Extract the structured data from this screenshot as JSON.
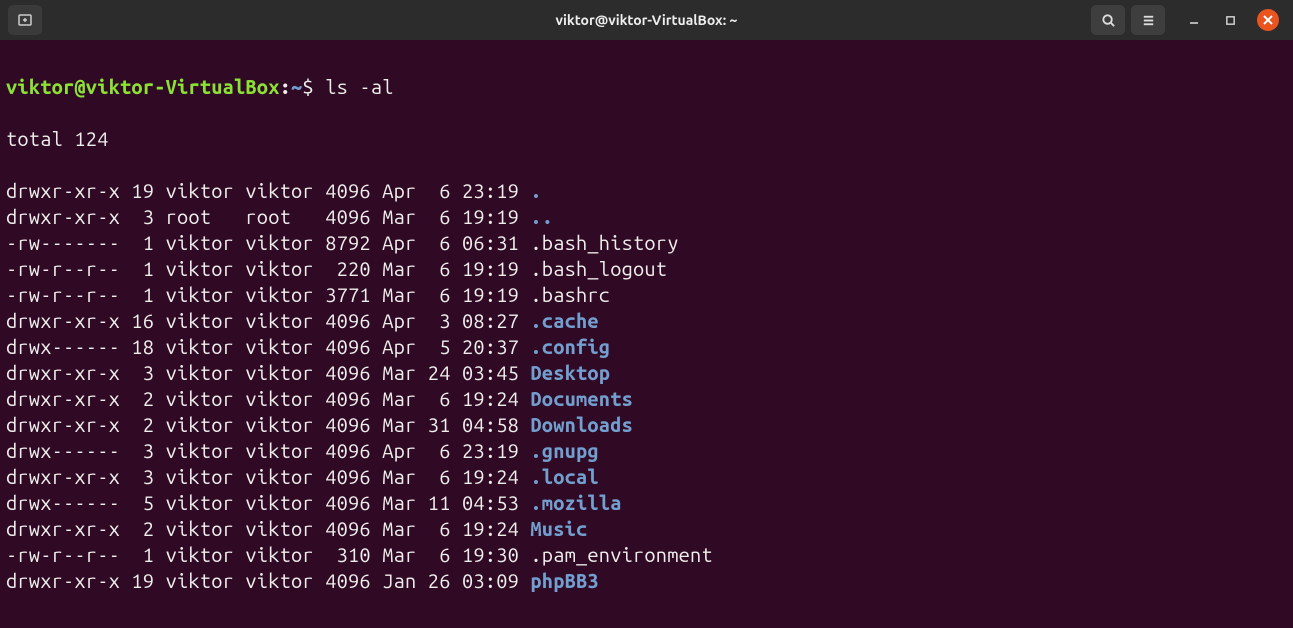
{
  "window": {
    "title": "viktor@viktor-VirtualBox: ~"
  },
  "prompt": {
    "user_host": "viktor@viktor-VirtualBox",
    "colon": ":",
    "path": "~",
    "symbol": "$",
    "command": "ls -al"
  },
  "total_line": "total 124",
  "listing": [
    {
      "perm": "drwxr-xr-x",
      "links": "19",
      "owner": "viktor",
      "group": "viktor",
      "size": "4096",
      "month": "Apr",
      "day": " 6",
      "time": "23:19",
      "name": ".",
      "dir": true
    },
    {
      "perm": "drwxr-xr-x",
      "links": " 3",
      "owner": "root  ",
      "group": "root  ",
      "size": "4096",
      "month": "Mar",
      "day": " 6",
      "time": "19:19",
      "name": "..",
      "dir": true
    },
    {
      "perm": "-rw-------",
      "links": " 1",
      "owner": "viktor",
      "group": "viktor",
      "size": "8792",
      "month": "Apr",
      "day": " 6",
      "time": "06:31",
      "name": ".bash_history",
      "dir": false
    },
    {
      "perm": "-rw-r--r--",
      "links": " 1",
      "owner": "viktor",
      "group": "viktor",
      "size": " 220",
      "month": "Mar",
      "day": " 6",
      "time": "19:19",
      "name": ".bash_logout",
      "dir": false
    },
    {
      "perm": "-rw-r--r--",
      "links": " 1",
      "owner": "viktor",
      "group": "viktor",
      "size": "3771",
      "month": "Mar",
      "day": " 6",
      "time": "19:19",
      "name": ".bashrc",
      "dir": false
    },
    {
      "perm": "drwxr-xr-x",
      "links": "16",
      "owner": "viktor",
      "group": "viktor",
      "size": "4096",
      "month": "Apr",
      "day": " 3",
      "time": "08:27",
      "name": ".cache",
      "dir": true
    },
    {
      "perm": "drwx------",
      "links": "18",
      "owner": "viktor",
      "group": "viktor",
      "size": "4096",
      "month": "Apr",
      "day": " 5",
      "time": "20:37",
      "name": ".config",
      "dir": true
    },
    {
      "perm": "drwxr-xr-x",
      "links": " 3",
      "owner": "viktor",
      "group": "viktor",
      "size": "4096",
      "month": "Mar",
      "day": "24",
      "time": "03:45",
      "name": "Desktop",
      "dir": true
    },
    {
      "perm": "drwxr-xr-x",
      "links": " 2",
      "owner": "viktor",
      "group": "viktor",
      "size": "4096",
      "month": "Mar",
      "day": " 6",
      "time": "19:24",
      "name": "Documents",
      "dir": true
    },
    {
      "perm": "drwxr-xr-x",
      "links": " 2",
      "owner": "viktor",
      "group": "viktor",
      "size": "4096",
      "month": "Mar",
      "day": "31",
      "time": "04:58",
      "name": "Downloads",
      "dir": true
    },
    {
      "perm": "drwx------",
      "links": " 3",
      "owner": "viktor",
      "group": "viktor",
      "size": "4096",
      "month": "Apr",
      "day": " 6",
      "time": "23:19",
      "name": ".gnupg",
      "dir": true
    },
    {
      "perm": "drwxr-xr-x",
      "links": " 3",
      "owner": "viktor",
      "group": "viktor",
      "size": "4096",
      "month": "Mar",
      "day": " 6",
      "time": "19:24",
      "name": ".local",
      "dir": true
    },
    {
      "perm": "drwx------",
      "links": " 5",
      "owner": "viktor",
      "group": "viktor",
      "size": "4096",
      "month": "Mar",
      "day": "11",
      "time": "04:53",
      "name": ".mozilla",
      "dir": true
    },
    {
      "perm": "drwxr-xr-x",
      "links": " 2",
      "owner": "viktor",
      "group": "viktor",
      "size": "4096",
      "month": "Mar",
      "day": " 6",
      "time": "19:24",
      "name": "Music",
      "dir": true
    },
    {
      "perm": "-rw-r--r--",
      "links": " 1",
      "owner": "viktor",
      "group": "viktor",
      "size": " 310",
      "month": "Mar",
      "day": " 6",
      "time": "19:30",
      "name": ".pam_environment",
      "dir": false
    },
    {
      "perm": "drwxr-xr-x",
      "links": "19",
      "owner": "viktor",
      "group": "viktor",
      "size": "4096",
      "month": "Jan",
      "day": "26",
      "time": "03:09",
      "name": "phpBB3",
      "dir": true
    }
  ]
}
